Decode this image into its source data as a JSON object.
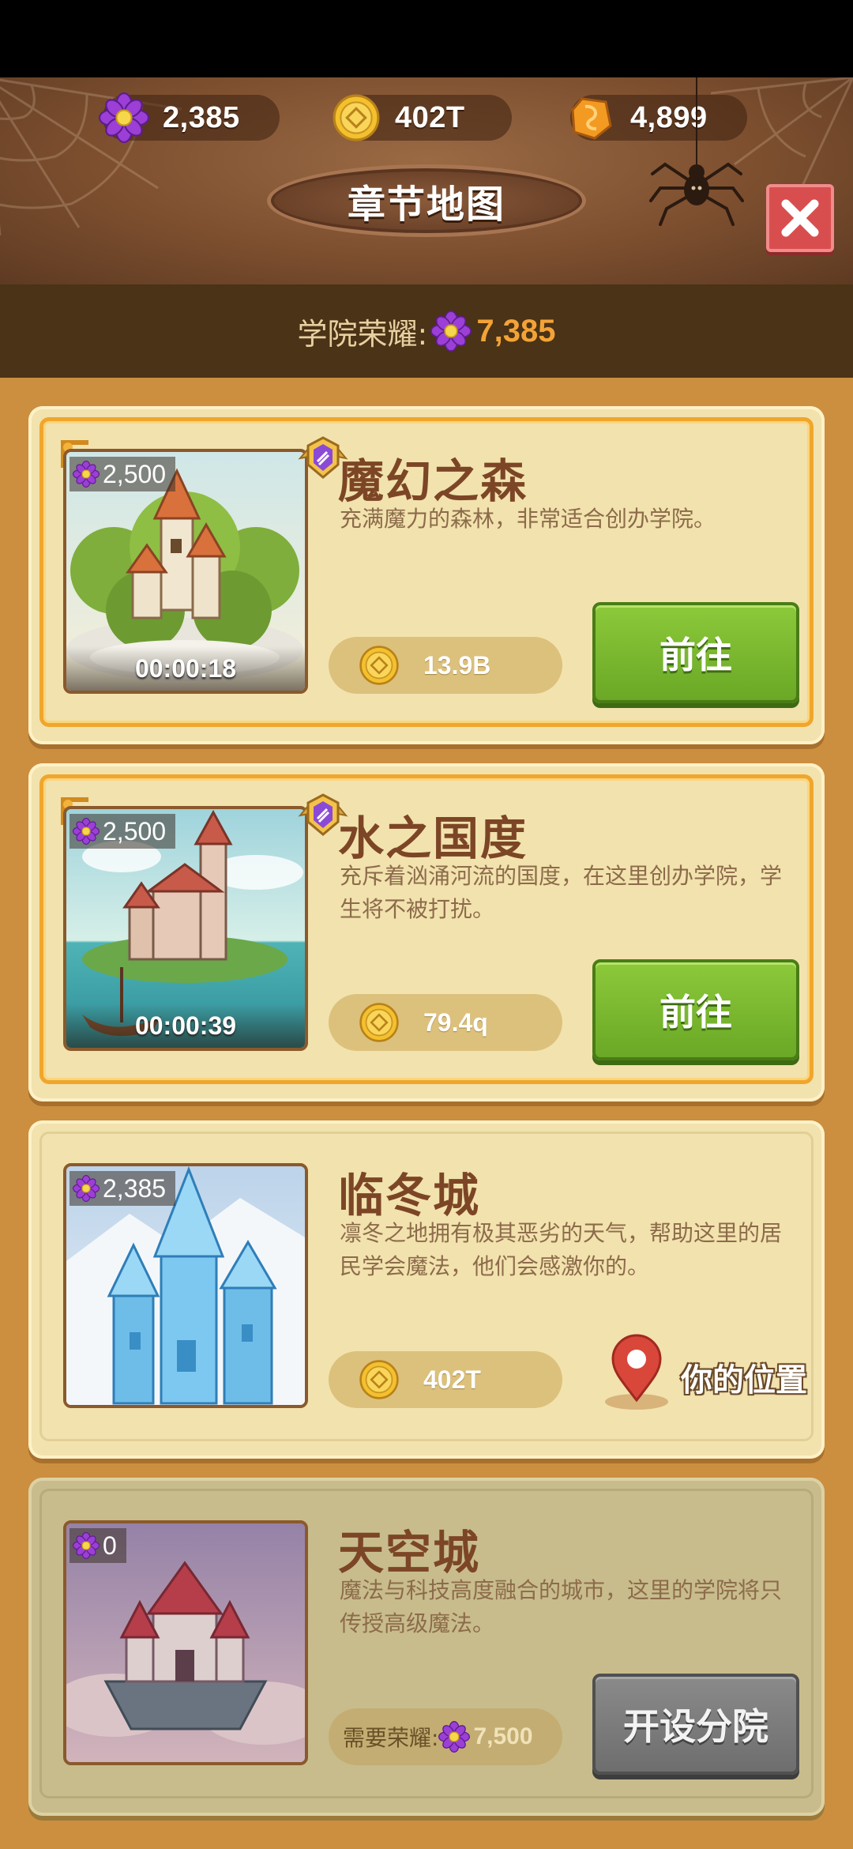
{
  "header": {
    "currencies": [
      {
        "icon": "purple-flower-icon",
        "value": "2,385"
      },
      {
        "icon": "gold-coin-icon",
        "value": "402T"
      },
      {
        "icon": "orange-gem-icon",
        "value": "4,899"
      }
    ],
    "title": "章节地图",
    "close_icon": "close-icon"
  },
  "honor": {
    "label": "学院荣耀:",
    "value": "7,385"
  },
  "chapters": [
    {
      "name": "魔幻之森",
      "description": "充满魔力的森林，非常适合创办学院。",
      "cost": "2,500",
      "timer": "00:00:18",
      "price": "13.9B",
      "action": "前往"
    },
    {
      "name": "水之国度",
      "description": "充斥着汹涌河流的国度，在这里创办学院，学生将不被打扰。",
      "cost": "2,500",
      "timer": "00:00:39",
      "price": "79.4q",
      "action": "前往"
    },
    {
      "name": "临冬城",
      "description": "凛冬之地拥有极其恶劣的天气，帮助这里的居民学会魔法，他们会感激你的。",
      "cost": "2,385",
      "price": "402T",
      "location_label": "你的位置"
    },
    {
      "name": "天空城",
      "description": "魔法与科技高度融合的城市，这里的学院将只传授高级魔法。",
      "cost": "0",
      "required_label": "需要荣耀:",
      "required_value": "7,500",
      "action": "开设分院"
    }
  ],
  "colors": {
    "accent_orange": "#f3a337",
    "go_green": "#7ab82e",
    "close_red": "#d84e4e"
  }
}
